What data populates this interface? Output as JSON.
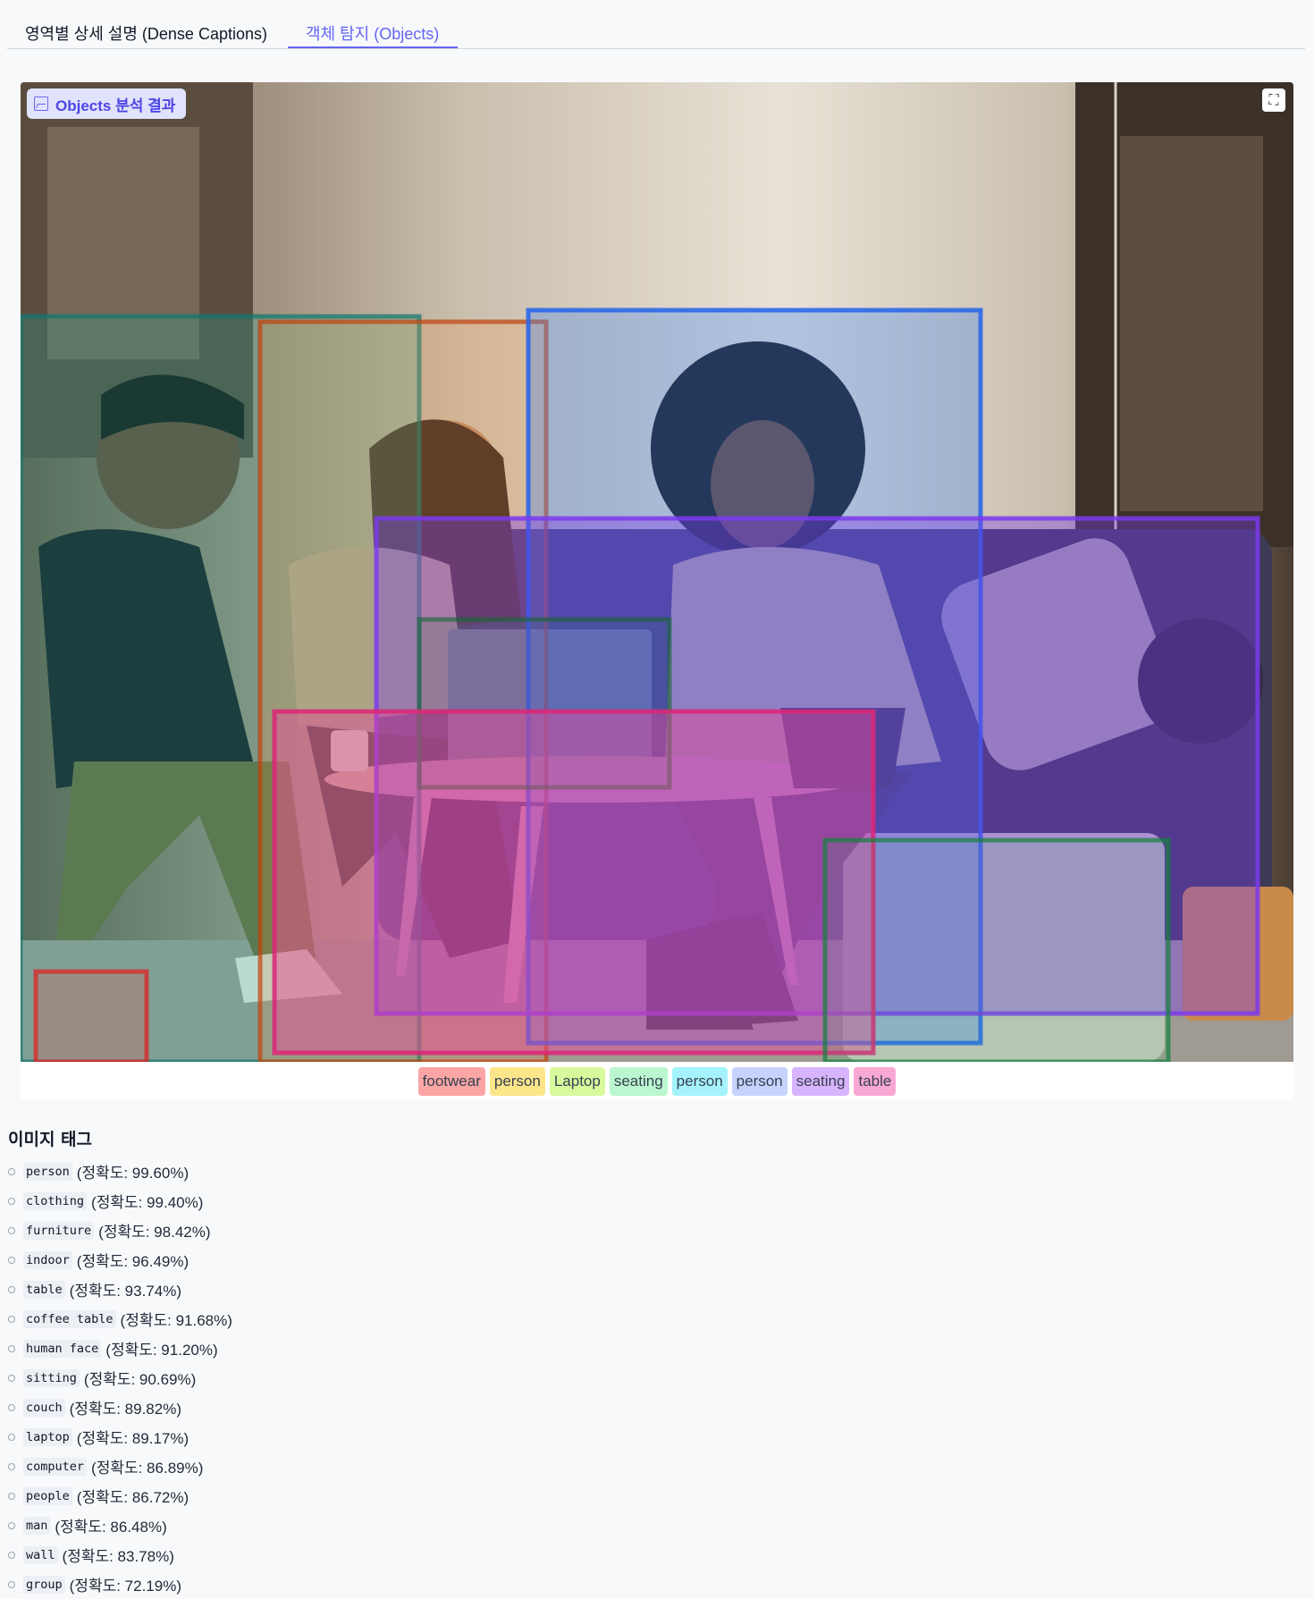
{
  "tabs": [
    {
      "label": "영역별 상세 설명 (Dense Captions)",
      "active": false
    },
    {
      "label": "객체 탐지 (Objects)",
      "active": true
    }
  ],
  "viewer": {
    "badge_label": "Objects 분석 결과",
    "badge_icon": "image-icon",
    "fullscreen_icon": "expand-icon"
  },
  "detections": [
    {
      "label": "footwear",
      "color": "#fca5a5"
    },
    {
      "label": "person",
      "color": "#fde68a"
    },
    {
      "label": "Laptop",
      "color": "#d9f99d"
    },
    {
      "label": "seating",
      "color": "#bbf7d0"
    },
    {
      "label": "person",
      "color": "#a5f3fc"
    },
    {
      "label": "person",
      "color": "#c7d2fe"
    },
    {
      "label": "seating",
      "color": "#d8b4fe"
    },
    {
      "label": "table",
      "color": "#f9a8d4"
    }
  ],
  "tags": {
    "title": "이미지 태그",
    "items": [
      {
        "name": "person",
        "confidence": "(정확도: 99.60%)"
      },
      {
        "name": "clothing",
        "confidence": "(정확도: 99.40%)"
      },
      {
        "name": "furniture",
        "confidence": "(정확도: 98.42%)"
      },
      {
        "name": "indoor",
        "confidence": "(정확도: 96.49%)"
      },
      {
        "name": "table",
        "confidence": "(정확도: 93.74%)"
      },
      {
        "name": "coffee table",
        "confidence": "(정확도: 91.68%)"
      },
      {
        "name": "human face",
        "confidence": "(정확도: 91.20%)"
      },
      {
        "name": "sitting",
        "confidence": "(정확도: 90.69%)"
      },
      {
        "name": "couch",
        "confidence": "(정확도: 89.82%)"
      },
      {
        "name": "laptop",
        "confidence": "(정확도: 89.17%)"
      },
      {
        "name": "computer",
        "confidence": "(정확도: 86.89%)"
      },
      {
        "name": "people",
        "confidence": "(정확도: 86.72%)"
      },
      {
        "name": "man",
        "confidence": "(정확도: 86.48%)"
      },
      {
        "name": "wall",
        "confidence": "(정확도: 83.78%)"
      },
      {
        "name": "group",
        "confidence": "(정확도: 72.19%)"
      }
    ]
  }
}
